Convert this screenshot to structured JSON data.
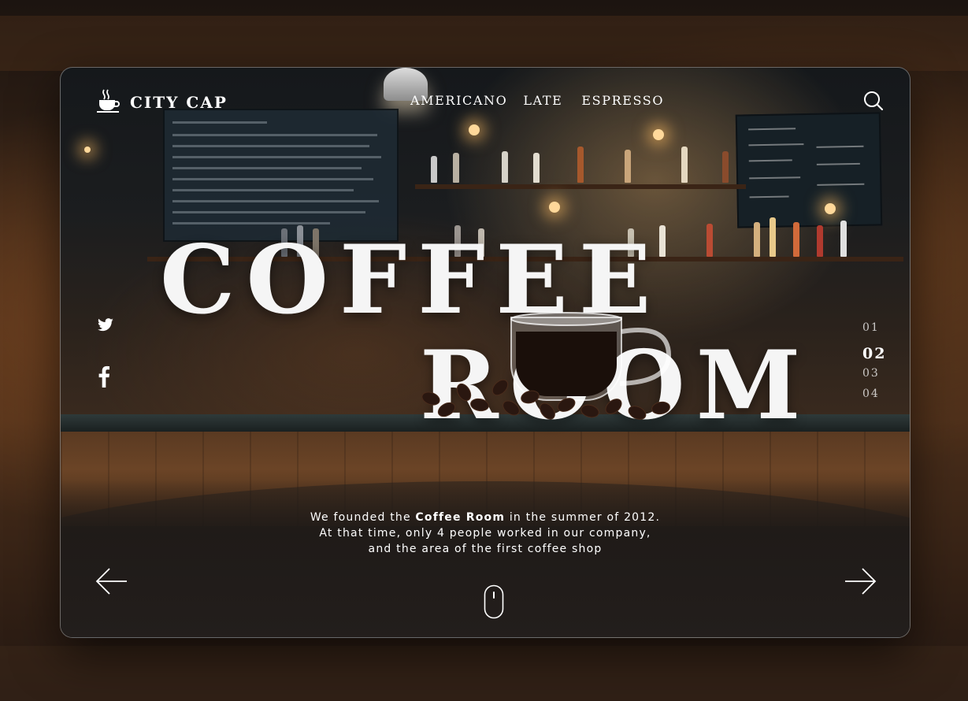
{
  "header": {
    "logo_text": "CITY CAP",
    "nav": [
      "AMERICANO",
      "LATE",
      "ESPRESSO"
    ]
  },
  "hero": {
    "line1": "COFFEE",
    "line2": "ROOM"
  },
  "description": {
    "part1": "We founded the ",
    "bold": "Coffee Room",
    "part2": " in the summer of 2012.",
    "line2": "At that time, only 4 people worked in our company,",
    "line3": "and the area of the first coffee shop"
  },
  "pager": {
    "items": [
      "01",
      "02",
      "03",
      "04"
    ],
    "active": "02"
  },
  "icons": {
    "logo": "coffee-cup-icon",
    "search": "search-icon",
    "twitter": "twitter-icon",
    "facebook": "facebook-icon",
    "prev": "arrow-left-icon",
    "next": "arrow-right-icon",
    "scroll": "mouse-scroll-icon"
  },
  "colors": {
    "text": "#ffffff",
    "card_border": "#d9d9d9"
  }
}
